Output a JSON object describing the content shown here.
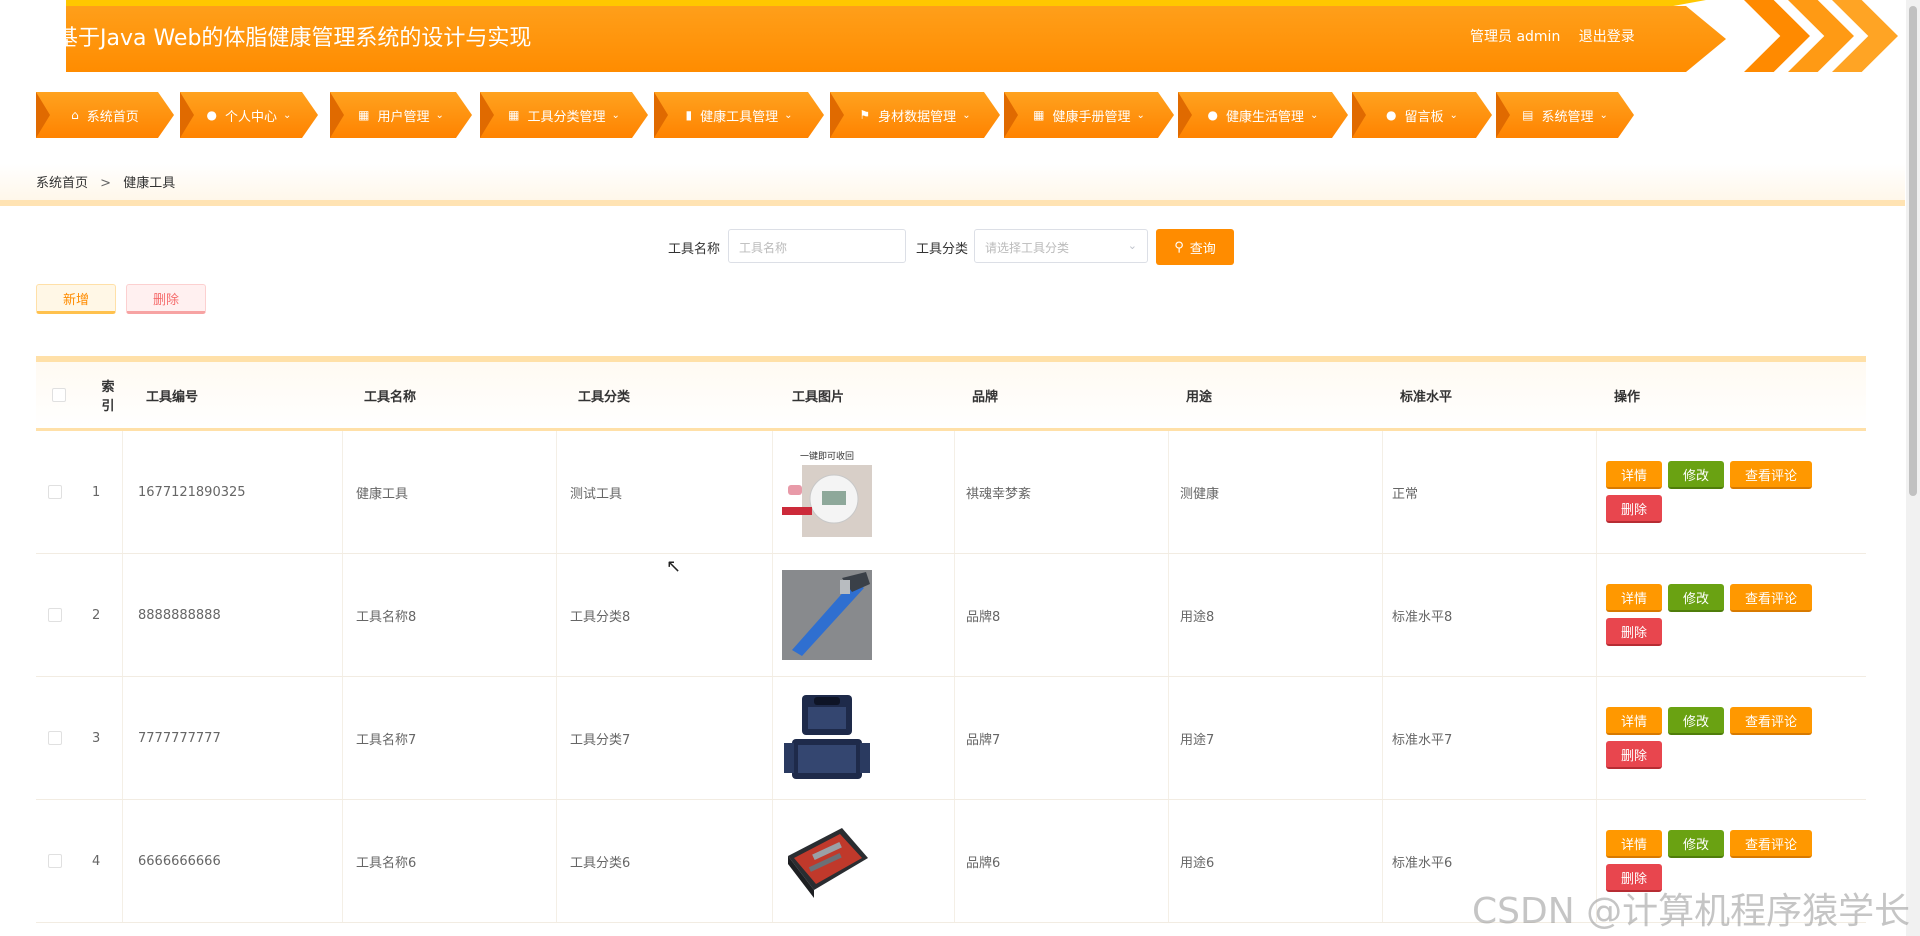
{
  "header": {
    "title": "基于Java Web的体脂健康管理系统的设计与实现",
    "user_label": "管理员 admin",
    "logout_label": "退出登录",
    "brand_color": "#ff8c00"
  },
  "nav": {
    "items": [
      {
        "label": "系统首页",
        "icon": "home-icon"
      },
      {
        "label": "个人中心",
        "icon": "user-icon"
      },
      {
        "label": "用户管理",
        "icon": "grid-icon"
      },
      {
        "label": "工具分类管理",
        "icon": "grid-icon"
      },
      {
        "label": "健康工具管理",
        "icon": "bar-chart-icon"
      },
      {
        "label": "身材数据管理",
        "icon": "flag-icon"
      },
      {
        "label": "健康手册管理",
        "icon": "grid-icon"
      },
      {
        "label": "健康生活管理",
        "icon": "user-icon"
      },
      {
        "label": "留言板",
        "icon": "pin-icon"
      },
      {
        "label": "系统管理",
        "icon": "print-icon"
      }
    ]
  },
  "breadcrumb": {
    "home": "系统首页",
    "separator": ">",
    "current": "健康工具"
  },
  "search": {
    "name_label": "工具名称",
    "name_placeholder": "工具名称",
    "category_label": "工具分类",
    "category_placeholder": "请选择工具分类",
    "button_label": "查询"
  },
  "actions": {
    "add_label": "新增",
    "delete_label": "删除"
  },
  "table": {
    "headers": {
      "index": "索引",
      "code": "工具编号",
      "name": "工具名称",
      "category": "工具分类",
      "image": "工具图片",
      "brand": "品牌",
      "usage": "用途",
      "standard": "标准水平",
      "ops": "操作"
    },
    "op_labels": {
      "detail": "详情",
      "edit": "修改",
      "comments": "查看评论",
      "remove": "删除"
    },
    "rows": [
      {
        "index": "1",
        "code": "1677121890325",
        "name": "健康工具",
        "category": "测试工具",
        "image_caption": "一键即可收回",
        "brand": "祺魂幸梦紊",
        "usage": "测健康",
        "standard": "正常"
      },
      {
        "index": "2",
        "code": "8888888888",
        "name": "工具名称8",
        "category": "工具分类8",
        "brand": "品牌8",
        "usage": "用途8",
        "standard": "标准水平8"
      },
      {
        "index": "3",
        "code": "7777777777",
        "name": "工具名称7",
        "category": "工具分类7",
        "brand": "品牌7",
        "usage": "用途7",
        "standard": "标准水平7"
      },
      {
        "index": "4",
        "code": "6666666666",
        "name": "工具名称6",
        "category": "工具分类6",
        "brand": "品牌6",
        "usage": "用途6",
        "standard": "标准水平6"
      }
    ]
  },
  "watermark": "CSDN @计算机程序猿学长"
}
